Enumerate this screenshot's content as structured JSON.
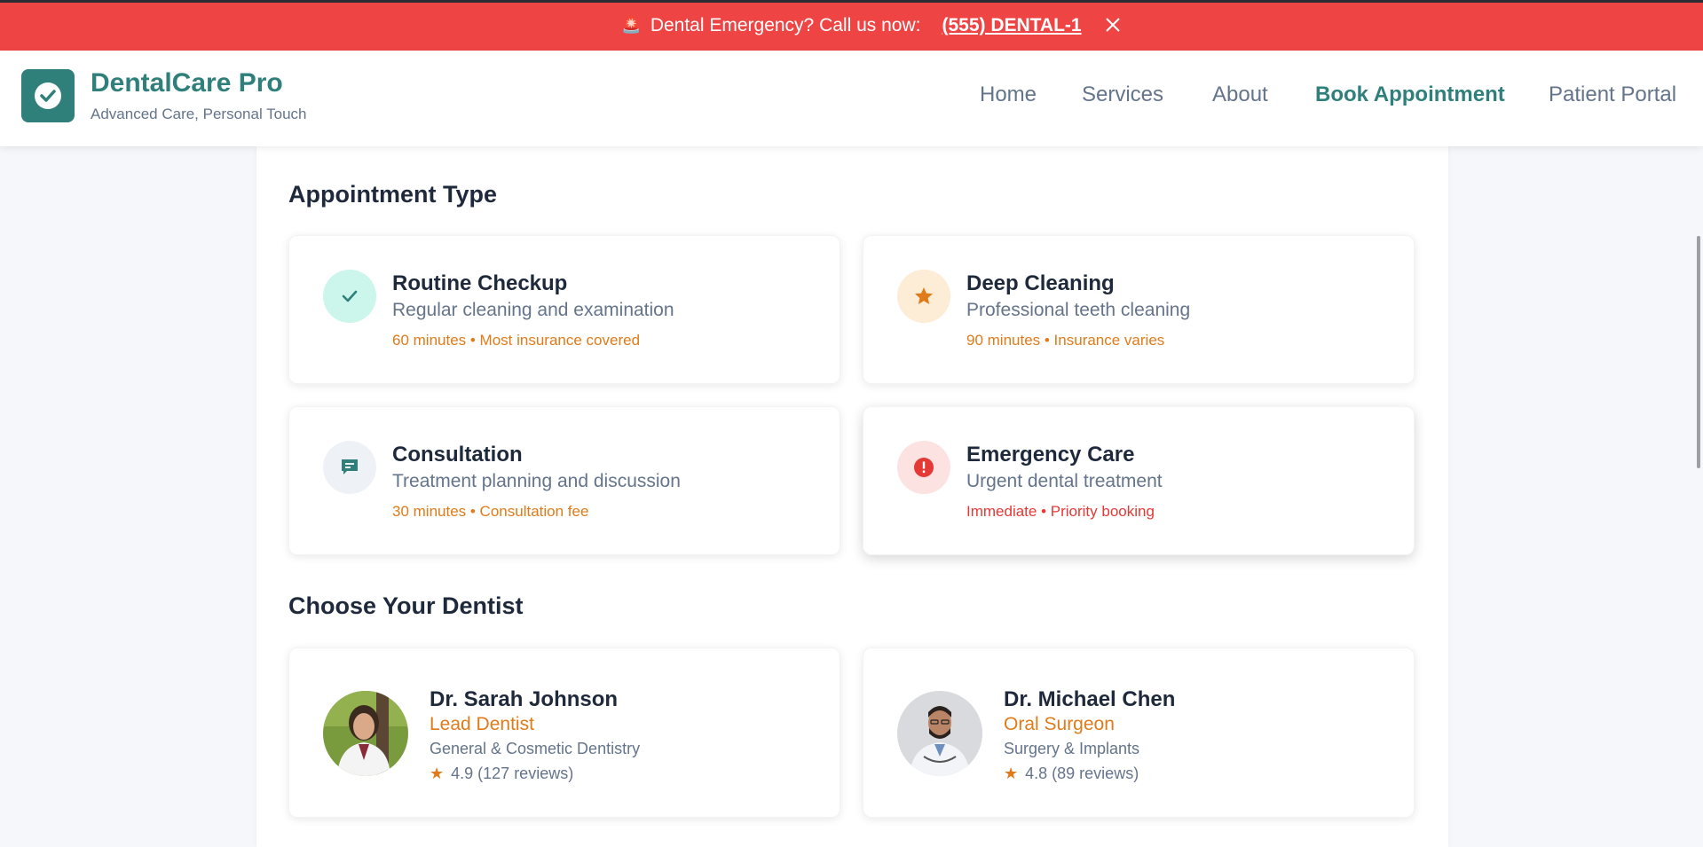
{
  "alert": {
    "icon": "siren-icon",
    "text": "Dental Emergency? Call us now:",
    "phone": "(555) DENTAL-1"
  },
  "brand": {
    "name": "DentalCare Pro",
    "tagline": "Advanced Care, Personal Touch",
    "color": "#2f7f7a"
  },
  "nav": {
    "home": "Home",
    "services": "Services",
    "about": "About",
    "book": "Book Appointment",
    "portal": "Patient Portal",
    "active": "Book Appointment"
  },
  "appointment": {
    "title": "Appointment Type",
    "types": [
      {
        "name": "Routine Checkup",
        "desc": "Regular cleaning and examination",
        "meta": "60 minutes • Most insurance covered",
        "icon": "check-icon"
      },
      {
        "name": "Deep Cleaning",
        "desc": "Professional teeth cleaning",
        "meta": "90 minutes • Insurance varies",
        "icon": "star-icon"
      },
      {
        "name": "Consultation",
        "desc": "Treatment planning and discussion",
        "meta": "30 minutes • Consultation fee",
        "icon": "chat-icon"
      },
      {
        "name": "Emergency Care",
        "desc": "Urgent dental treatment",
        "meta": "Immediate • Priority booking",
        "icon": "alert-icon"
      }
    ]
  },
  "dentists": {
    "title": "Choose Your Dentist",
    "list": [
      {
        "name": "Dr. Sarah Johnson",
        "role": "Lead Dentist",
        "specialty": "General & Cosmetic Dentistry",
        "rating": "4.9 (127 reviews)"
      },
      {
        "name": "Dr. Michael Chen",
        "role": "Oral Surgeon",
        "specialty": "Surgery & Implants",
        "rating": "4.8 (89 reviews)"
      }
    ]
  },
  "colors": {
    "alert": "#ef4444",
    "accent": "#e07b1a",
    "teal": "#2f7f7a"
  }
}
